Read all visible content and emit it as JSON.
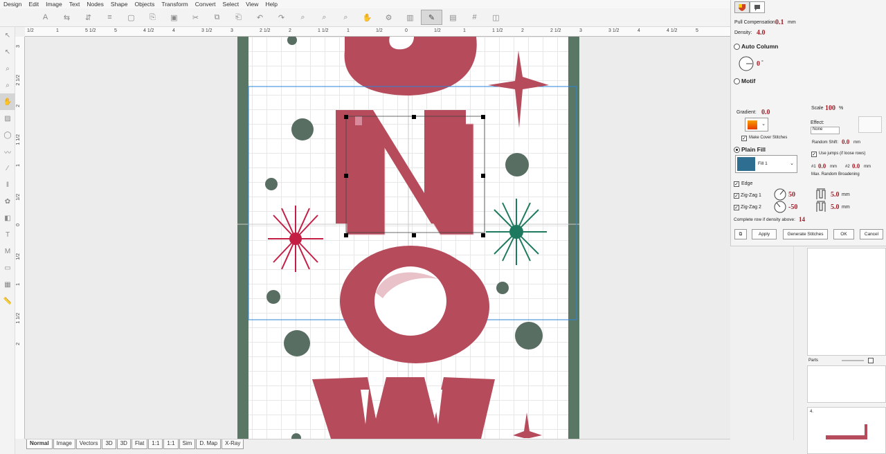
{
  "menu": [
    "Design",
    "Edit",
    "Image",
    "Text",
    "Nodes",
    "Shape",
    "Objects",
    "Transform",
    "Convert",
    "Select",
    "View",
    "Help"
  ],
  "toolbar_icons": [
    "text-tool",
    "align",
    "align-2",
    "align-3",
    "new",
    "open",
    "save",
    "cut",
    "copy",
    "paste",
    "undo",
    "redo",
    "zoom",
    "zoom-2",
    "zoom-3",
    "pan",
    "stitch",
    "fill",
    "edit",
    "properties",
    "grid",
    "view"
  ],
  "ruler_top": [
    "1/2",
    "1",
    "5 1/2",
    "5",
    "4 1/2",
    "4",
    "3 1/2",
    "3",
    "2 1/2",
    "2",
    "1 1/2",
    "1",
    "1/2",
    "0",
    "1/2",
    "1",
    "1 1/2",
    "2",
    "2 1/2",
    "3",
    "3 1/2",
    "4",
    "4 1/2",
    "5"
  ],
  "ruler_left": [
    "3",
    "2 1/2",
    "2",
    "1 1/2",
    "1",
    "1/2",
    "0",
    "1/2",
    "1",
    "1 1/2",
    "2"
  ],
  "tool_icons": [
    "select",
    "node",
    "zoom",
    "shape",
    "pan",
    "fill",
    "outline",
    "satin",
    "run",
    "column",
    "motif",
    "applique",
    "text",
    "monogram",
    "border",
    "pattern",
    "measure"
  ],
  "bottom_tabs": [
    "Normal",
    "Image",
    "Vectors",
    "3D",
    "3D",
    "Flat",
    "1:1",
    "1:1",
    "Sim",
    "D. Map",
    "X-Ray"
  ],
  "panel": {
    "pull_comp_label": "Pull Compensation:",
    "pull_comp_value": "0.1",
    "pull_comp_unit": "mm",
    "density_label": "Density:",
    "density_value": "4.0",
    "auto_column_label": "Auto Column",
    "angle_value": "0",
    "angle_unit": "°",
    "motif_label": "Motif",
    "gradient_label": "Gradient:",
    "gradient_value": "0.0",
    "scale_label": "Scale",
    "scale_value": "100",
    "scale_unit": "%",
    "effect_label": "Effect:",
    "effect_value": "None",
    "make_cover_label": "Make Cover Stitches",
    "random_shift_label": "Random Shift:",
    "random_shift_value": "0.0",
    "random_shift_unit": "mm",
    "plain_fill_label": "Plain Fill",
    "fill_name": "Fill 1",
    "use_jumps_label": "Use jumps (if loose rows)",
    "r1_label": "#1",
    "r1_value": "0.0",
    "r1_unit": "mm",
    "r2_label": "#2",
    "r2_value": "0.0",
    "r2_unit": "mm",
    "max_random_label": "Max. Random Broadening",
    "edge_label": "Edge",
    "zigzag1_label": "Zig-Zag 1",
    "zigzag1_angle": "50",
    "zigzag1_size": "5.0",
    "zigzag2_label": "Zig-Zag 2",
    "zigzag2_angle": "-50",
    "zigzag2_size": "5.0",
    "size_unit": "mm",
    "complete_row_label": "Complete row if density above:",
    "complete_row_value": "14",
    "apply_label": "Apply",
    "generate_label": "Generate Stitches",
    "ok_label": "OK",
    "cancel_label": "Cancel"
  },
  "side_panel": {
    "parts_label": "Parts",
    "thumb_label": "4."
  },
  "colors": {
    "rose": "#b64b5c",
    "green_dot": "#586e62",
    "band": "#5a7766",
    "snowflake_red": "#c41e45",
    "snowflake_green": "#1e7a5e",
    "selection_blue": "#2b86d9",
    "value_red": "#a0202a",
    "fill_swatch": "#2e6e90"
  }
}
